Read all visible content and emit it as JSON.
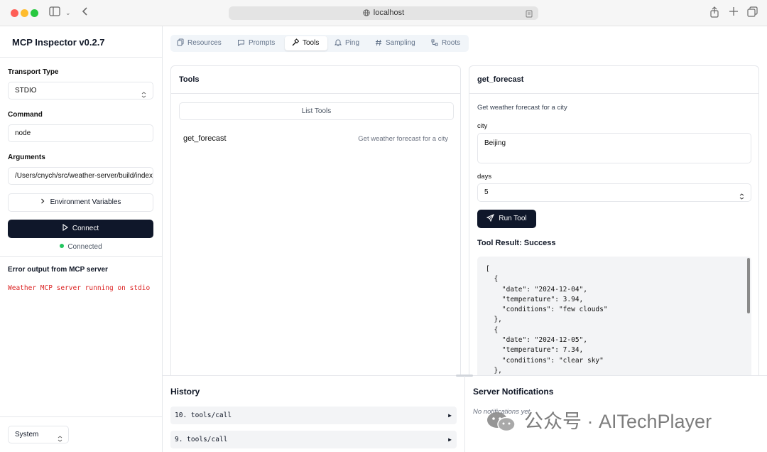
{
  "browser": {
    "url": "localhost"
  },
  "sidebar": {
    "app_title": "MCP Inspector v0.2.7",
    "transport_label": "Transport Type",
    "transport_value": "STDIO",
    "command_label": "Command",
    "command_value": "node",
    "arguments_label": "Arguments",
    "arguments_value": "/Users/cnych/src/weather-server/build/index.js",
    "env_button": "Environment Variables",
    "connect_button": "Connect",
    "status": "Connected",
    "error_title": "Error output from MCP server",
    "error_text": "Weather MCP server running on stdio",
    "theme_value": "System"
  },
  "tabs": [
    {
      "label": "Resources",
      "icon": "files-icon"
    },
    {
      "label": "Prompts",
      "icon": "message-icon"
    },
    {
      "label": "Tools",
      "icon": "hammer-icon"
    },
    {
      "label": "Ping",
      "icon": "bell-icon"
    },
    {
      "label": "Sampling",
      "icon": "hash-icon"
    },
    {
      "label": "Roots",
      "icon": "tree-icon"
    }
  ],
  "active_tab": "Tools",
  "tools_panel": {
    "title": "Tools",
    "list_button": "List Tools",
    "tools": [
      {
        "name": "get_forecast",
        "description": "Get weather forecast for a city"
      }
    ]
  },
  "detail_panel": {
    "title": "get_forecast",
    "description": "Get weather forecast for a city",
    "city_label": "city",
    "city_value": "Beijing",
    "days_label": "days",
    "days_value": "5",
    "run_button": "Run Tool",
    "result_title": "Tool Result: Success",
    "result_text": "[\n  {\n    \"date\": \"2024-12-04\",\n    \"temperature\": 3.94,\n    \"conditions\": \"few clouds\"\n  },\n  {\n    \"date\": \"2024-12-05\",\n    \"temperature\": 7.34,\n    \"conditions\": \"clear sky\"\n  },"
  },
  "history": {
    "title": "History",
    "items": [
      "10. tools/call",
      "9. tools/call"
    ]
  },
  "notifications": {
    "title": "Server Notifications",
    "empty_text": "No notifications yet"
  },
  "watermark": "公众号 · AITechPlayer",
  "colors": {
    "primary": "#0f172a",
    "connected": "#22c55e",
    "error": "#dc2626"
  }
}
